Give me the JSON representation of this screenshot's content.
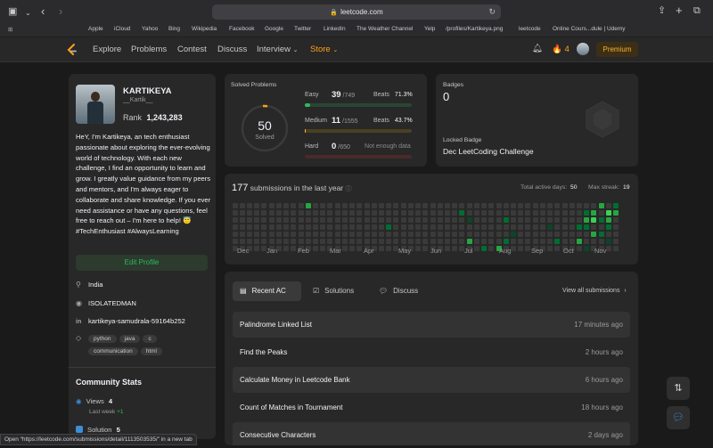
{
  "browser": {
    "url": "leetcode.com",
    "bookmarks": [
      "Apple",
      "iCloud",
      "Yahoo",
      "Bing",
      "Wikipedia",
      "Facebook",
      "Google",
      "Twitter",
      "LinkedIn",
      "The Weather Channel",
      "Yelp",
      "/profiles/Kartikeya.png",
      "leetcode",
      "Online Cours...dule | Udemy"
    ],
    "status_text": "Open “https://leetcode.com/submissions/detail/1113503535/” in a new tab"
  },
  "nav": {
    "items": [
      "Explore",
      "Problems",
      "Contest",
      "Discuss",
      "Interview",
      "Store"
    ],
    "streak": "4",
    "premium": "Premium",
    "store_color": "#ffa116"
  },
  "profile": {
    "name": "KARTIKEYA",
    "username": "__Kartik__",
    "rank_label": "Rank",
    "rank": "1,243,283",
    "bio": "HeY, I'm Kartikeya, an tech enthusiast passionate about exploring the ever-evolving world of technology. With each new challenge, I find an opportunity to learn and grow. I greatly value guidance from my peers and mentors, and I'm always eager to collaborate and share knowledge. If you ever need assistance or have any questions, feel free to reach out – I'm here to help! 😇 #TechEnthusiast #AlwaysLearning",
    "edit_button": "Edit Profile",
    "location": "India",
    "github": "ISOLATEDMAN",
    "linkedin": "kartikeya-samudrala-59164b252",
    "skills": [
      "python",
      "java",
      "c",
      "communication",
      "html"
    ],
    "community_title": "Community Stats",
    "views_label": "Views",
    "views": "4",
    "views_week": "Last week",
    "views_week_delta": "+1",
    "solution_label": "Solution",
    "solution": "5"
  },
  "solved": {
    "title": "Solved Problems",
    "total": "50",
    "total_label": "Solved",
    "easy": {
      "label": "Easy",
      "solved": "39",
      "total": "/749",
      "beats_label": "Beats",
      "beats": "71.3%",
      "color": "#2cbb5d",
      "fraction": 0.052
    },
    "medium": {
      "label": "Medium",
      "solved": "11",
      "total": "/1555",
      "beats_label": "Beats",
      "beats": "43.7%",
      "color": "#ffc01e",
      "fraction": 0.007
    },
    "hard": {
      "label": "Hard",
      "solved": "0",
      "total": "/650",
      "note": "Not enough data",
      "color": "#ef4743",
      "fraction": 0
    }
  },
  "badges": {
    "title": "Badges",
    "count": "0",
    "locked_label": "Locked Badge",
    "locked_name": "Dec LeetCoding Challenge"
  },
  "submissions": {
    "count": "177",
    "label": "submissions in the last year",
    "active_days_label": "Total active days:",
    "active_days": "50",
    "max_streak_label": "Max streak:",
    "max_streak": "19",
    "months": [
      "Dec",
      "Jan",
      "Feb",
      "Mar",
      "Apr",
      "May",
      "Jun",
      "Jul",
      "Aug",
      "Sep",
      "Oct",
      "Nov"
    ]
  },
  "recent": {
    "tabs": [
      "Recent AC",
      "Solutions",
      "Discuss"
    ],
    "view_all": "View all submissions",
    "items": [
      {
        "title": "Palindrome Linked List",
        "when": "17 minutes ago"
      },
      {
        "title": "Find the Peaks",
        "when": "2 hours ago"
      },
      {
        "title": "Calculate Money in Leetcode Bank",
        "when": "6 hours ago"
      },
      {
        "title": "Count of Matches in Tournament",
        "when": "18 hours ago"
      },
      {
        "title": "Consecutive Characters",
        "when": "2 days ago"
      }
    ]
  }
}
